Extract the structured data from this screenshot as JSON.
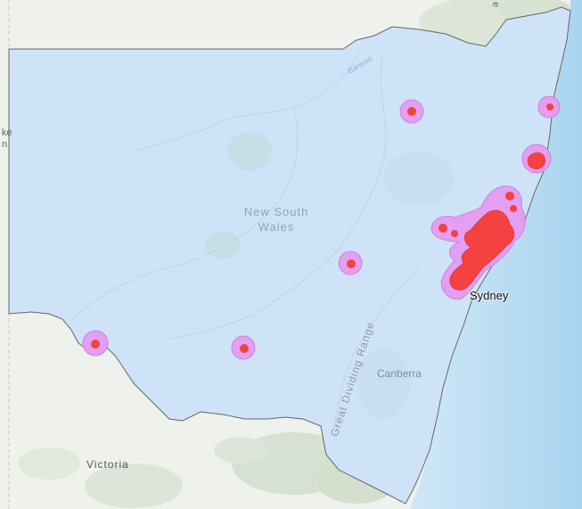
{
  "map": {
    "labels": {
      "state": "New South Wales",
      "state_line1": "New South",
      "state_line2": "Wales",
      "sydney": "Sydney",
      "canberra": "Canberra",
      "victoria": "Victoria",
      "range": "Great Dividing Range",
      "river": "Barwon",
      "edge_left_1": "ke",
      "edge_left_2": "n",
      "edge_top": "e"
    },
    "colors": {
      "land": "#eef1ec",
      "ocean": "#b9ddf4",
      "region_fill": "#cfe3f8",
      "region_border": "#666666",
      "buffer_fill": "#e49ef2",
      "buffer_stroke": "#c686d8",
      "point_fill": "#f5413f",
      "point_stroke": "#cc3333"
    },
    "features": {
      "buffers": [
        "buffer-northern-inland",
        "buffer-north-coast",
        "buffer-mid-north-coast",
        "buffer-central-west",
        "buffer-far-west",
        "buffer-riverina",
        "buffer-sydney-region"
      ]
    }
  }
}
